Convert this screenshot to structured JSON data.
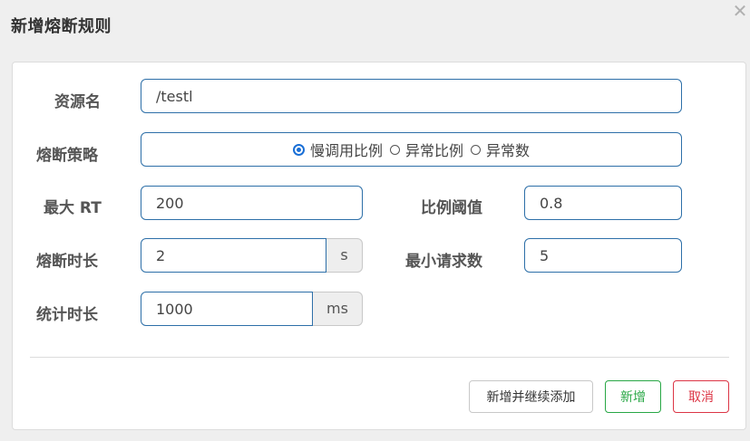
{
  "dialog": {
    "title": "新增熔断规则",
    "close_icon": "✕"
  },
  "form": {
    "resource": {
      "label": "资源名",
      "value": "/testl"
    },
    "strategy": {
      "label": "熔断策略",
      "options": [
        {
          "label": "慢调用比例",
          "checked": true
        },
        {
          "label": "异常比例",
          "checked": false
        },
        {
          "label": "异常数",
          "checked": false
        }
      ]
    },
    "max_rt": {
      "label": "最大 RT",
      "value": "200"
    },
    "ratio_threshold": {
      "label": "比例阈值",
      "value": "0.8"
    },
    "break_duration": {
      "label": "熔断时长",
      "value": "2",
      "unit": "s"
    },
    "min_requests": {
      "label": "最小请求数",
      "value": "5"
    },
    "stat_duration": {
      "label": "统计时长",
      "value": "1000",
      "unit": "ms"
    }
  },
  "buttons": {
    "add_continue": "新增并继续添加",
    "add": "新增",
    "cancel": "取消"
  },
  "colors": {
    "input_border": "#2d6fa8",
    "radio_accent": "#1a6fd6",
    "add_green": "#28a745",
    "cancel_red": "#dc3545"
  }
}
